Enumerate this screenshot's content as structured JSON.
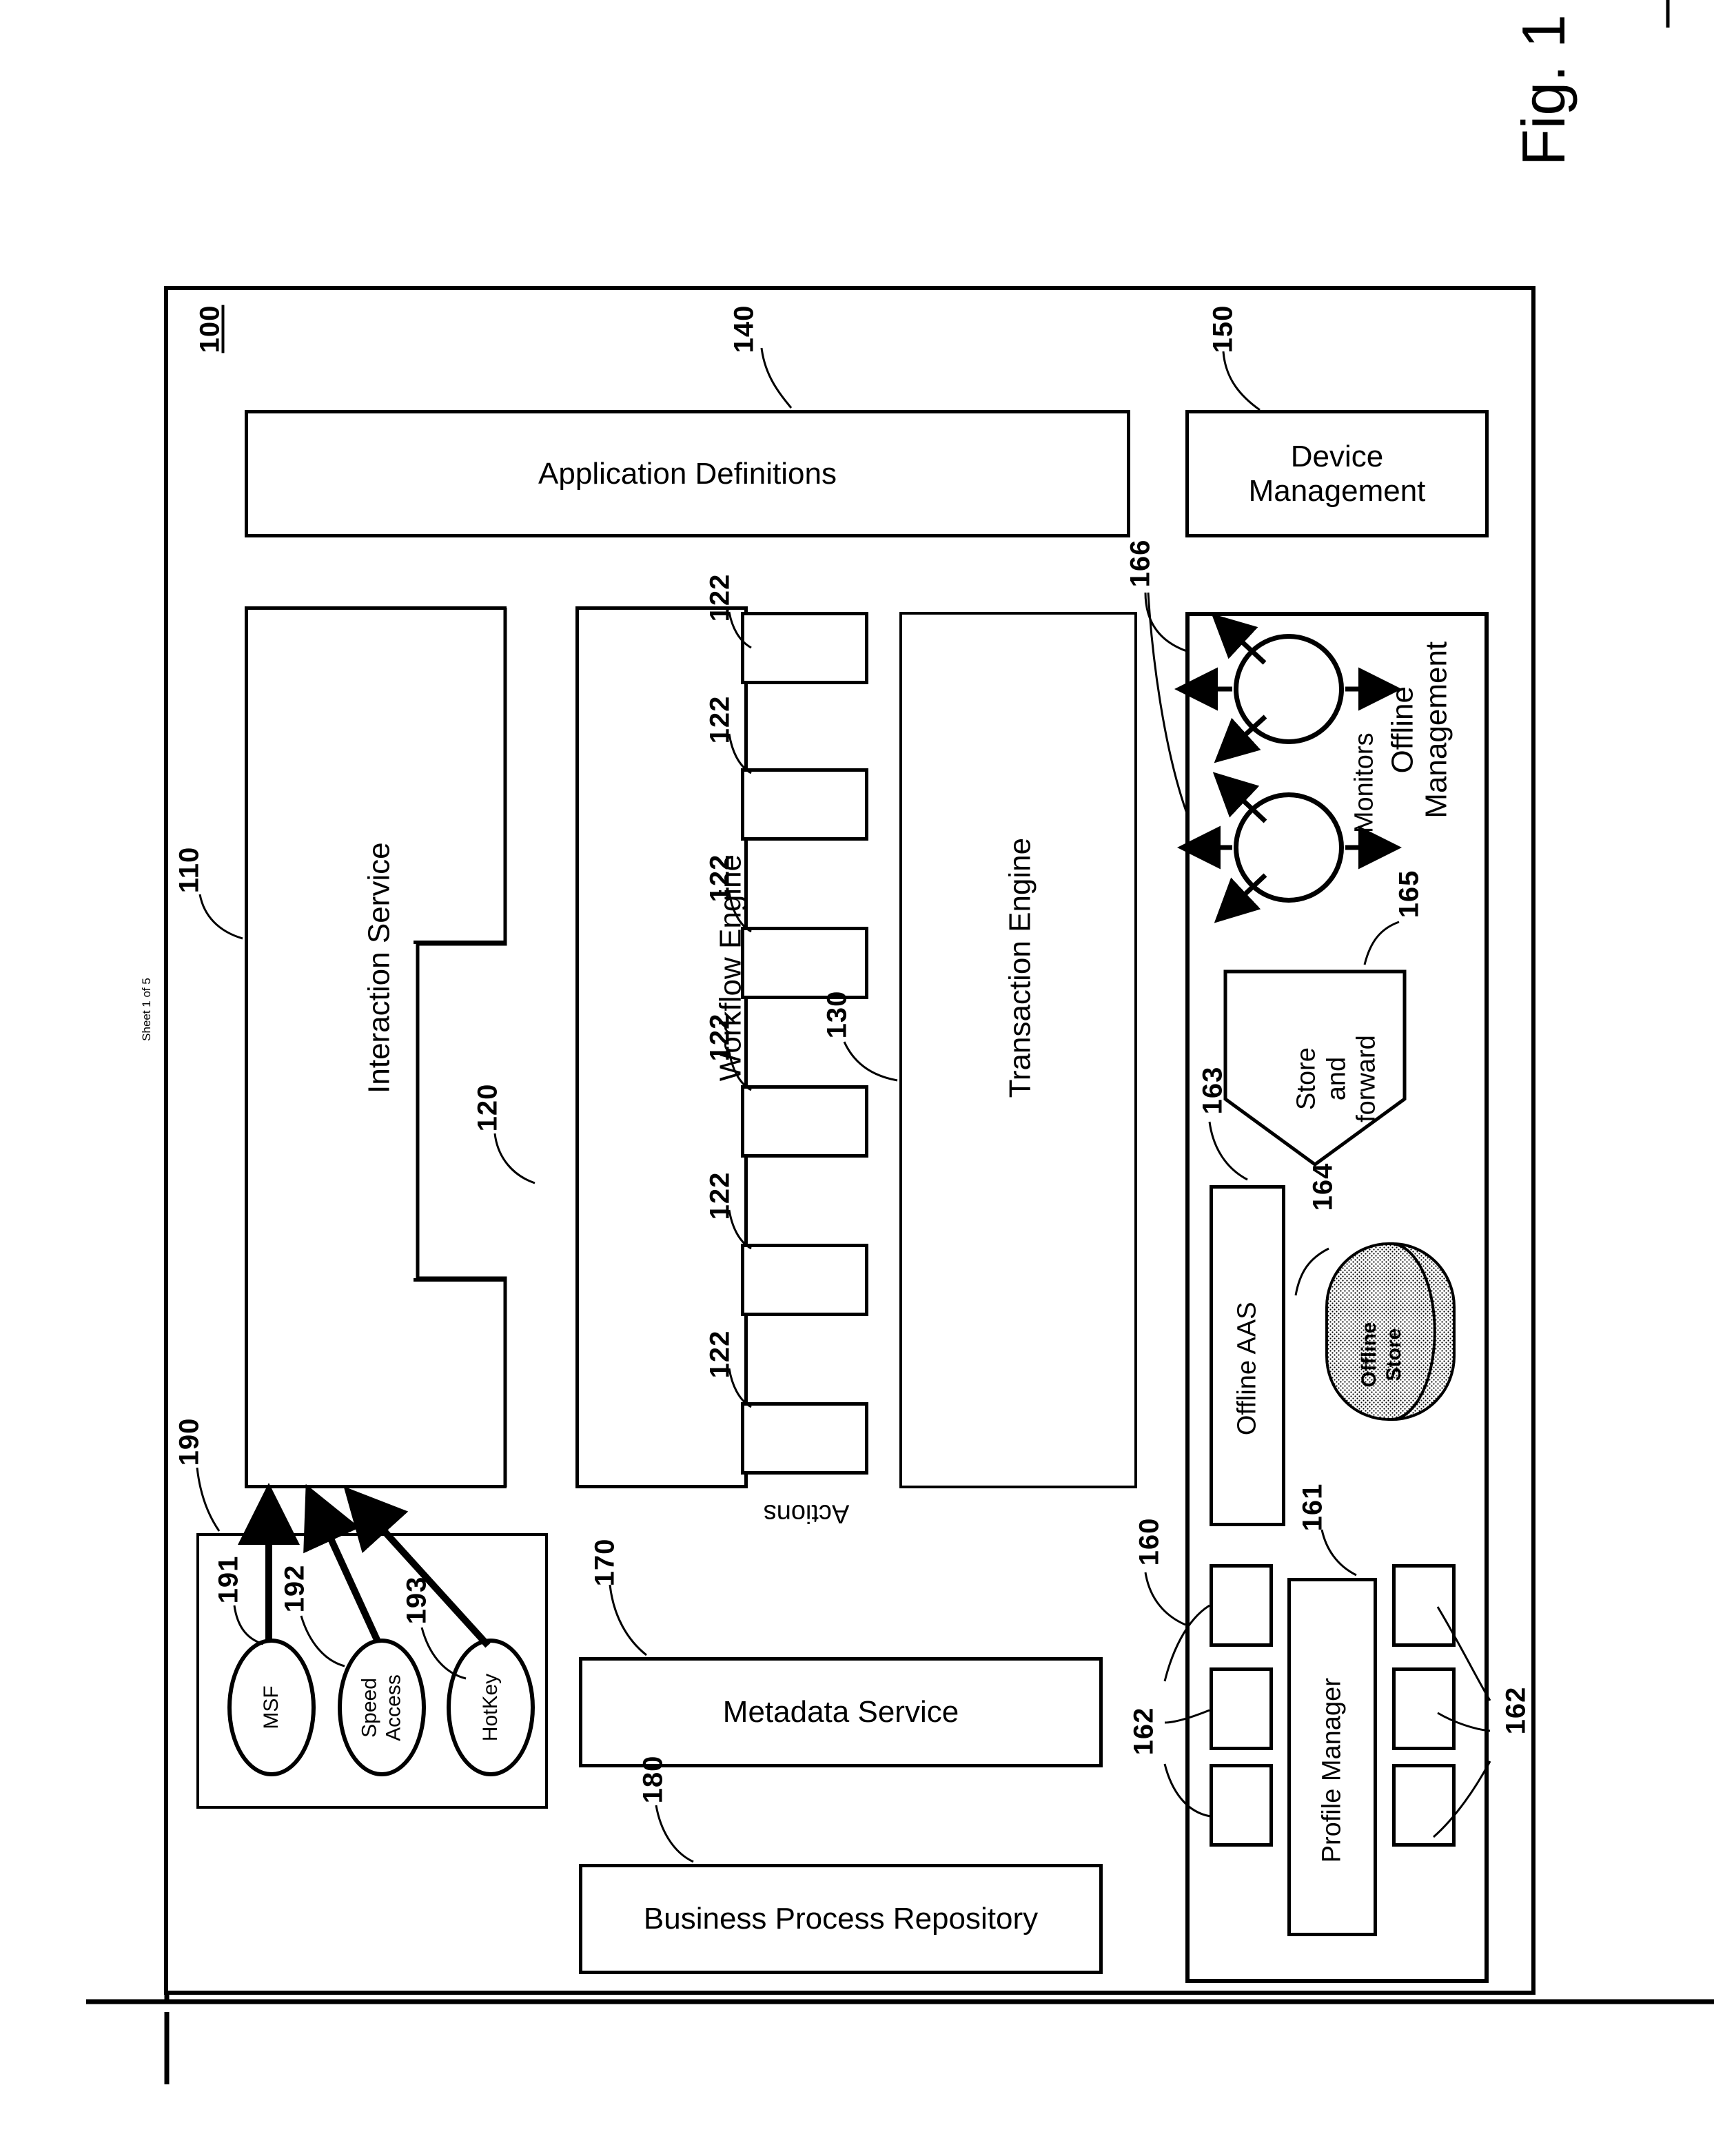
{
  "figure": {
    "label": "Fig. 1",
    "sheet_note": "Sheet 1 of 5"
  },
  "diagram": {
    "orientation": "landscape-rotated-90",
    "system_ref": "100",
    "blocks": [
      {
        "id": "application-definitions",
        "label": "Application Definitions",
        "ref": "140"
      },
      {
        "id": "device-management",
        "label": "Device\nManagement",
        "ref": "150"
      },
      {
        "id": "interaction-service",
        "label": "Interaction Service",
        "ref": "110"
      },
      {
        "id": "workflow-engine",
        "label": "Workflow Engine",
        "ref": "120"
      },
      {
        "id": "transaction-engine",
        "label": "Transaction Engine",
        "ref": "130"
      },
      {
        "id": "metadata-service",
        "label": "Metadata Service",
        "ref": "170"
      },
      {
        "id": "business-process-repository",
        "label": "Business Process Repository",
        "ref": "180"
      },
      {
        "id": "offline-management",
        "label": "Offline\nManagement",
        "ref": "160"
      },
      {
        "id": "offline-aas",
        "label": "Offline AAS",
        "ref": "163"
      },
      {
        "id": "offline-store",
        "label": "Offline\nStore",
        "ref": "164"
      },
      {
        "id": "store-and-forward",
        "label": "Store\nand\nforward",
        "ref": "165"
      },
      {
        "id": "profile-manager",
        "label": "Profile Manager",
        "ref": "161"
      }
    ],
    "actions": {
      "group_label": "Actions",
      "item_ref": "122",
      "count": 6,
      "refs": [
        "122",
        "122",
        "122",
        "122",
        "122",
        "122"
      ]
    },
    "monitors": {
      "label": "Monitors",
      "ref": "166",
      "count": 2
    },
    "profile_items": {
      "ref": "162",
      "count": 6,
      "left_label": "162",
      "right_label": "162"
    },
    "client_group": {
      "ref": "190",
      "items": [
        {
          "label": "MSF",
          "ref": "191"
        },
        {
          "label": "Speed\nAccess",
          "ref": "192"
        },
        {
          "label": "HotKey",
          "ref": "193"
        }
      ]
    },
    "labels": {
      "line_100": "100",
      "line_110": "110",
      "line_120": "120",
      "line_122": "122",
      "line_130": "130",
      "line_140": "140",
      "line_150": "150",
      "line_160": "160",
      "line_161": "161",
      "line_162": "162",
      "line_163": "163",
      "line_164": "164",
      "line_165": "165",
      "line_166": "166",
      "line_170": "170",
      "line_180": "180",
      "line_190": "190",
      "line_191": "191",
      "line_192": "192",
      "line_193": "193"
    },
    "colors": {
      "ink": "#000000",
      "paper": "#ffffff"
    }
  }
}
